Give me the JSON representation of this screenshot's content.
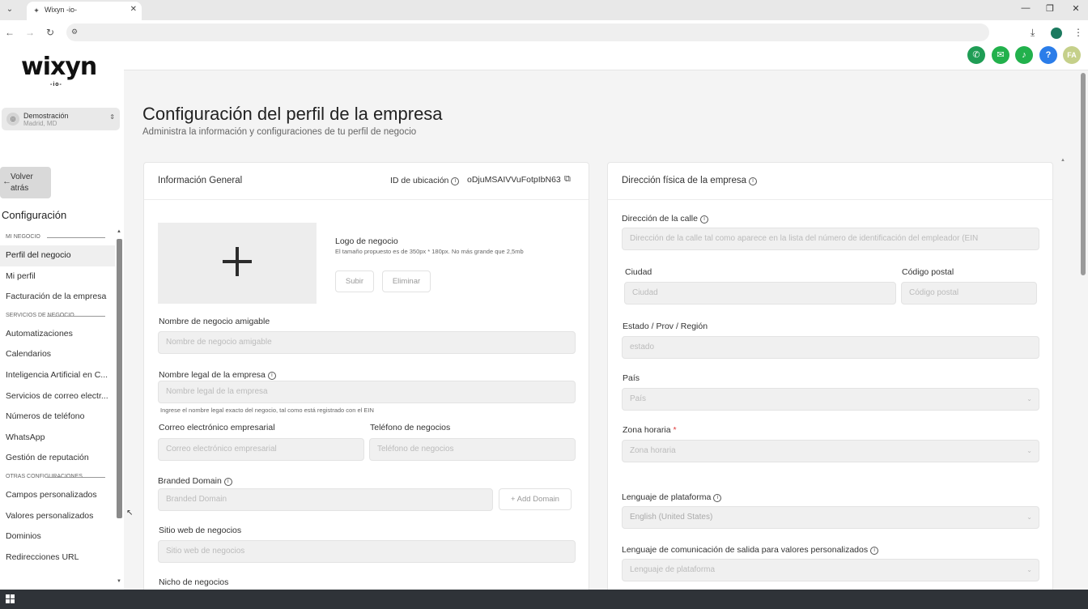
{
  "browser": {
    "tab_title": "Wixyn -io-",
    "controls": {
      "minimize": "—",
      "maximize": "❐",
      "close": "✕"
    }
  },
  "sidebar": {
    "logo_main": "wixyn",
    "logo_sub": "-io-",
    "account_name": "Demostración",
    "account_location": "Madrid, MD",
    "back_label": "Volver atrás",
    "title": "Configuración",
    "sections": [
      {
        "label": "MI NEGOCIO",
        "items": [
          "Perfil del negocio",
          "Mi perfil",
          "Facturación de la empresa"
        ]
      },
      {
        "label": "SERVICIOS DE NEGOCIO",
        "items": [
          "Automatizaciones",
          "Calendarios",
          "Inteligencia Artificial en C...",
          "Servicios de correo electr...",
          "Números de teléfono",
          "WhatsApp",
          "Gestión de reputación"
        ]
      },
      {
        "label": "OTRAS CONFIGURACIONES",
        "items": [
          "Campos personalizados",
          "Valores personalizados",
          "Dominios",
          "Redirecciones URL"
        ]
      }
    ],
    "active_item": "Perfil del negocio"
  },
  "header": {
    "buttons": [
      {
        "name": "phone",
        "color": "#1f9d55"
      },
      {
        "name": "megaphone",
        "color": "#22b14c"
      },
      {
        "name": "bell",
        "color": "#22b14c"
      },
      {
        "name": "help",
        "color": "#2b7de9"
      },
      {
        "name": "user-avatar",
        "color": "#c5d08a",
        "initials": "FA"
      }
    ]
  },
  "page": {
    "title": "Configuración del perfil de la empresa",
    "subtitle": "Administra la información y configuraciones de tu perfil de negocio"
  },
  "general_card": {
    "title": "Información General",
    "location_label": "ID de ubicación",
    "location_id": "oDjuMSAIVVuFotpIbN63",
    "logo_label": "Logo de negocio",
    "logo_hint": "El tamaño propuesto es de 350px * 180px. No más grande que 2,5mb",
    "upload_label": "Subir",
    "delete_label": "Eliminar",
    "friendly_name_label": "Nombre de negocio amigable",
    "friendly_name_placeholder": "Nombre de negocio amigable",
    "legal_name_label": "Nombre legal de la empresa",
    "legal_name_placeholder": "Nombre legal de la empresa",
    "legal_name_hint": "Ingrese el nombre legal exacto del negocio, tal como está registrado con el EIN",
    "email_label": "Correo electrónico empresarial",
    "email_placeholder": "Correo electrónico empresarial",
    "phone_label": "Teléfono de negocios",
    "phone_placeholder": "Teléfono de negocios",
    "domain_label": "Branded Domain",
    "domain_placeholder": "Branded Domain",
    "add_domain_label": "+ Add Domain",
    "website_label": "Sitio web de negocios",
    "website_placeholder": "Sitio web de negocios",
    "niche_label": "Nicho de negocios"
  },
  "address_card": {
    "title": "Dirección física de la empresa",
    "street_label": "Dirección de la calle",
    "street_placeholder": "Dirección de la calle tal como aparece en la lista del número de identificación del empleador (EIN",
    "city_label": "Ciudad",
    "city_placeholder": "Ciudad",
    "postal_label": "Código postal",
    "postal_placeholder": "Código postal",
    "state_label": "Estado / Prov / Región",
    "state_placeholder": "estado",
    "country_label": "País",
    "country_placeholder": "País",
    "timezone_label": "Zona horaria",
    "timezone_required": "*",
    "timezone_placeholder": "Zona horaria",
    "platform_lang_label": "Lenguaje de plataforma",
    "platform_lang_value": "English (United States)",
    "outbound_lang_label": "Lenguaje de comunicación de salida para valores personalizados",
    "outbound_lang_placeholder": "Lenguaje de plataforma"
  }
}
